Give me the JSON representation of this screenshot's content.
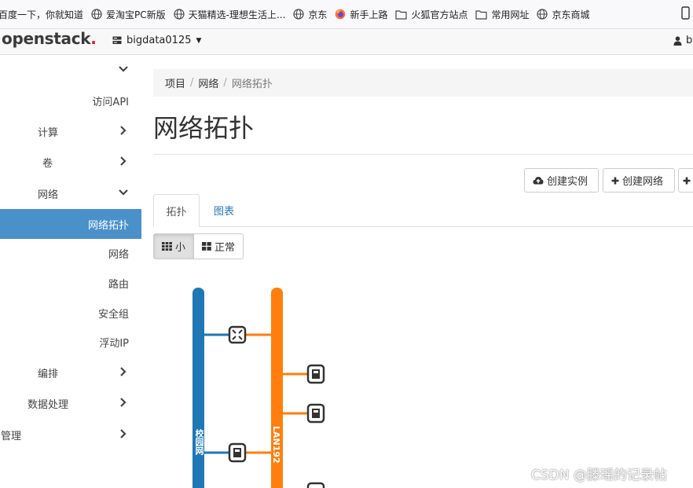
{
  "bookmarks": [
    {
      "icon": "none",
      "label": "百度一下，你就知道"
    },
    {
      "icon": "globe-icon",
      "label": "爱淘宝PC新版"
    },
    {
      "icon": "globe-icon",
      "label": "天猫精选-理想生活上..."
    },
    {
      "icon": "globe-icon",
      "label": "京东"
    },
    {
      "icon": "firefox-icon",
      "label": "新手上路"
    },
    {
      "icon": "folder-icon",
      "label": "火狐官方站点"
    },
    {
      "icon": "folder-icon",
      "label": "常用网址"
    },
    {
      "icon": "globe-icon",
      "label": "京东商城"
    }
  ],
  "navbar": {
    "brand": "openstack",
    "brand_dot": ".",
    "project": "bigdata0125",
    "user": "bi"
  },
  "sidebar": {
    "items": [
      {
        "label": "",
        "chevron": "down"
      },
      {
        "label": "访问API",
        "chevron": "none"
      },
      {
        "label": "计算",
        "chevron": "right"
      },
      {
        "label": "卷",
        "chevron": "right"
      },
      {
        "label": "网络",
        "chevron": "down"
      },
      {
        "label": "网络拓扑",
        "chevron": "none",
        "active": true
      },
      {
        "label": "网络",
        "chevron": "none"
      },
      {
        "label": "路由",
        "chevron": "none"
      },
      {
        "label": "安全组",
        "chevron": "none"
      },
      {
        "label": "浮动IP",
        "chevron": "none"
      },
      {
        "label": "编排",
        "chevron": "right"
      },
      {
        "label": "数据处理",
        "chevron": "right"
      },
      {
        "label": "管理",
        "chevron": "right"
      }
    ]
  },
  "breadcrumb": [
    "项目",
    "网络",
    "网络拓扑"
  ],
  "page_title": "网络拓扑",
  "actions": {
    "create_instance": "创建实例",
    "create_network": "创建网络"
  },
  "tabs": [
    "拓扑",
    "图表"
  ],
  "view_size": {
    "small": "小",
    "normal": "正常"
  },
  "topology": {
    "networks": [
      {
        "name": "校园网",
        "color": "#1f77b4"
      },
      {
        "name": "LAN192",
        "color": "#ff7f0e"
      }
    ]
  },
  "watermark": "CSDN @滕瑶的记录帖",
  "colors": {
    "active": "#4a90c9",
    "link": "#2a76b6",
    "brand_dot": "#da1a32"
  }
}
